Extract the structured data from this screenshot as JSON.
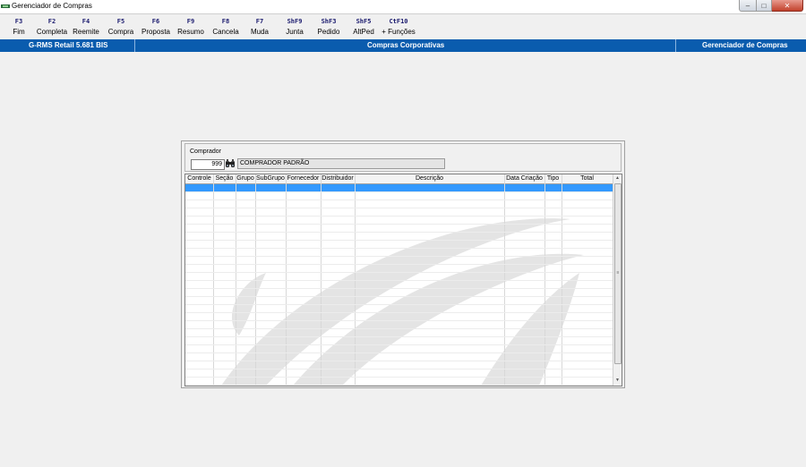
{
  "window": {
    "title": "Gerenciador de Compras",
    "min": "–",
    "max": "□",
    "close": "✕"
  },
  "toolbar": [
    {
      "key": "F3",
      "label": "Fim"
    },
    {
      "key": "F2",
      "label": "Completa"
    },
    {
      "key": "F4",
      "label": "Reemite"
    },
    {
      "key": "F5",
      "label": "Compra"
    },
    {
      "key": "F6",
      "label": "Proposta"
    },
    {
      "key": "F9",
      "label": "Resumo"
    },
    {
      "key": "F8",
      "label": "Cancela"
    },
    {
      "key": "F7",
      "label": "Muda"
    },
    {
      "key": "ShF9",
      "label": "Junta"
    },
    {
      "key": "ShF3",
      "label": "Pedido"
    },
    {
      "key": "ShF5",
      "label": "AltPed"
    },
    {
      "key": "CtF10",
      "label": "+ Funções"
    }
  ],
  "status_band": {
    "left": "G-RMS Retail 5.681 BIS",
    "center": "Compras Corporativas",
    "right": "Gerenciador de Compras"
  },
  "comprador": {
    "label": "Comprador",
    "code": "999",
    "name": "COMPRADOR PADRÃO"
  },
  "grid": {
    "columns": [
      "Controle",
      "Seção",
      "Grupo",
      "SubGrupo",
      "Fornecedor",
      "Distribuidor",
      "Descrição",
      "Data Criação",
      "Tipo",
      "Total"
    ],
    "rows": []
  },
  "scrollbar": {
    "up": "▲",
    "down": "▼",
    "grip": "≡"
  },
  "colors": {
    "band": "#0a5cae",
    "selection": "#3399ff",
    "key_text": "#1a1a6e"
  }
}
